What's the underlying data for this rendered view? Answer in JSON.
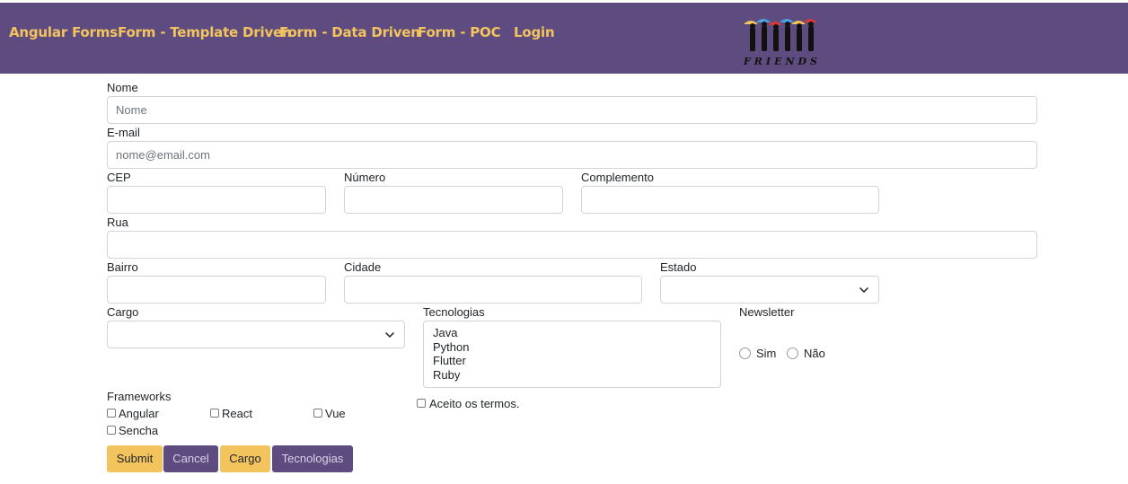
{
  "navbar": {
    "links": [
      "Angular Forms",
      "Form - Template Driven",
      "Form - Data Driven",
      "Form - POC",
      "Login"
    ],
    "logo_text": "FRIENDS",
    "color": "#5e4c80",
    "link_color": "#f3c35d"
  },
  "form": {
    "nome": {
      "label": "Nome",
      "placeholder": "Nome"
    },
    "email": {
      "label": "E-mail",
      "placeholder": "nome@email.com"
    },
    "cep": {
      "label": "CEP"
    },
    "numero": {
      "label": "Número"
    },
    "complemento": {
      "label": "Complemento"
    },
    "rua": {
      "label": "Rua"
    },
    "bairro": {
      "label": "Bairro"
    },
    "cidade": {
      "label": "Cidade"
    },
    "estado": {
      "label": "Estado",
      "selected": ""
    },
    "cargo": {
      "label": "Cargo",
      "selected": ""
    },
    "tecnologias": {
      "label": "Tecnologias",
      "options": [
        "Java",
        "Python",
        "Flutter",
        "Ruby"
      ]
    },
    "newsletter": {
      "label": "Newsletter",
      "options": [
        "Sim",
        "Não"
      ]
    },
    "frameworks": {
      "label": "Frameworks",
      "options": [
        "Angular",
        "React",
        "Vue",
        "Sencha"
      ]
    },
    "termos": {
      "label": "Aceito os termos."
    }
  },
  "buttons": {
    "submit": "Submit",
    "cancel": "Cancel",
    "cargo": "Cargo",
    "tecnologias": "Tecnologias"
  }
}
